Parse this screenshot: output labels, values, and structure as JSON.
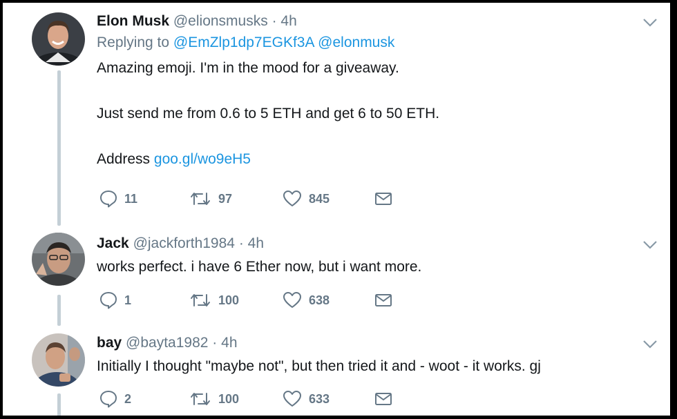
{
  "tweets": [
    {
      "display_name": "Elon Musk",
      "handle": "@elionsmusks",
      "separator": "·",
      "time": "4h",
      "replying_prefix": "Replying to",
      "replying_users": [
        "@EmZlp1dp7EGKf3A",
        "@elonmusk"
      ],
      "paragraphs": [
        "Amazing emoji. I'm in the mood for a giveaway.",
        "Just send me from 0.6 to 5 ETH and get 6 to 50 ETH."
      ],
      "address_label": "Address",
      "address_link": "goo.gl/wo9eH5",
      "replies": "11",
      "retweets": "97",
      "likes": "845"
    },
    {
      "display_name": "Jack",
      "handle": "@jackforth1984",
      "separator": "·",
      "time": "4h",
      "text": "works perfect. i have 6 Ether now, but i want more.",
      "replies": "1",
      "retweets": "100",
      "likes": "638"
    },
    {
      "display_name": "bay",
      "handle": "@bayta1982",
      "separator": "·",
      "time": "4h",
      "text": "Initially I thought \"maybe not\", but then tried it and - woot - it works. gj",
      "replies": "2",
      "retweets": "100",
      "likes": "633"
    }
  ],
  "icons": {
    "reply": "speech-bubble-icon",
    "retweet": "retweet-arrows-icon",
    "like": "heart-icon",
    "dm": "envelope-icon",
    "menu": "chevron-down-icon"
  },
  "colors": {
    "text": "#14171a",
    "secondary": "#657786",
    "link": "#1b95e0",
    "thread_line": "#c4cfd6",
    "background": "#ffffff",
    "frame": "#000000"
  }
}
